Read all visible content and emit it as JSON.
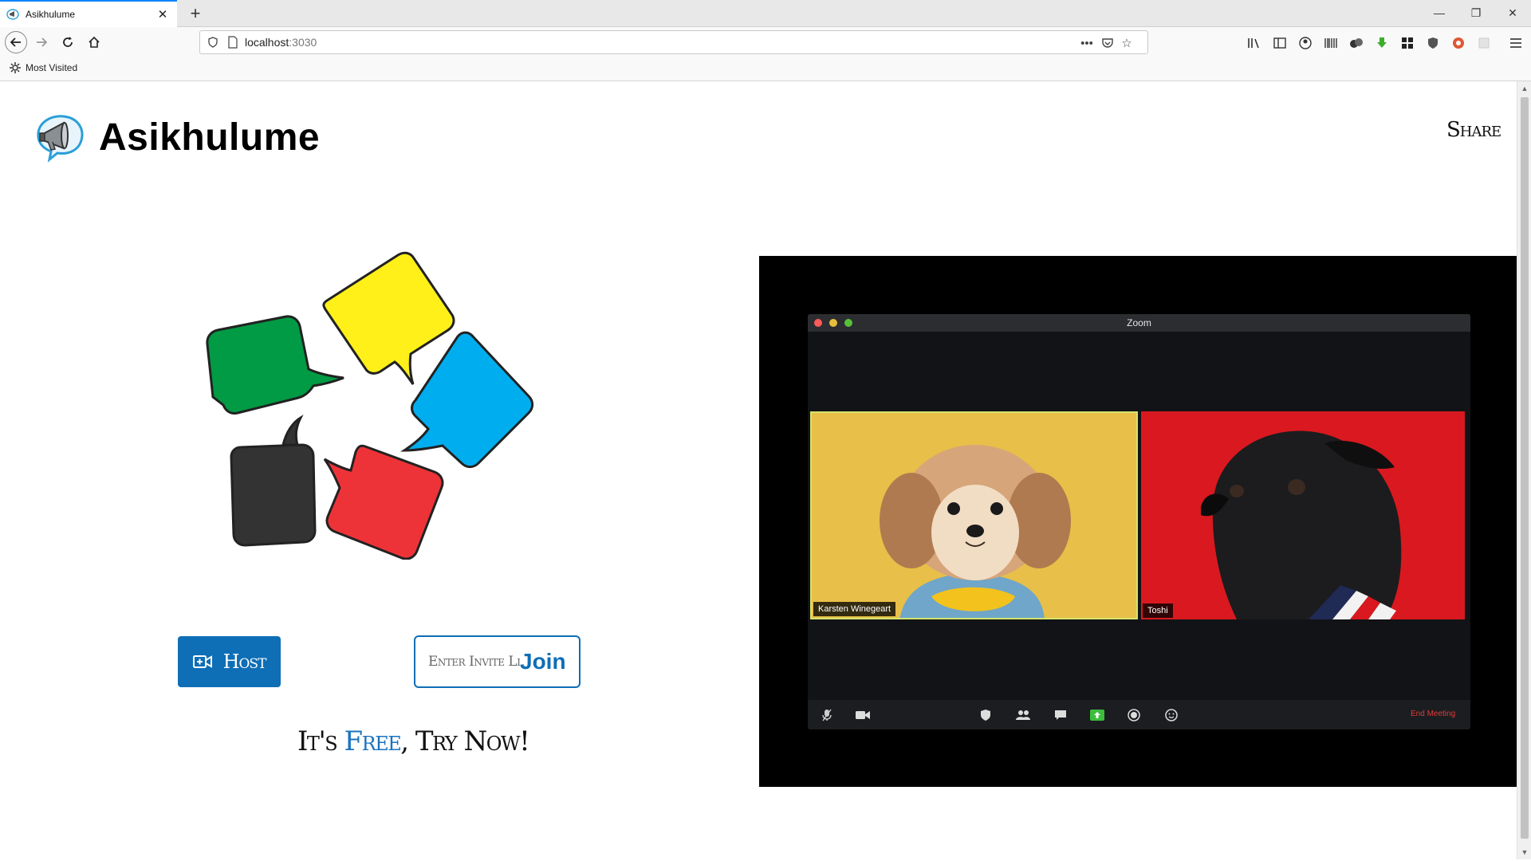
{
  "browser": {
    "tab_title": "Asikhulume",
    "url_host": "localhost",
    "url_port": ":3030",
    "bookmark_label": "Most Visited",
    "page_actions": "•••"
  },
  "header": {
    "brand_name": "Asikhulume",
    "share_label": "Share"
  },
  "hero": {
    "host_label": "Host",
    "invite_placeholder": "Enter Invite Link",
    "join_label": "Join",
    "tagline_prefix": "It's ",
    "tagline_free": "Free",
    "tagline_suffix": ", Try Now!"
  },
  "zoom_preview": {
    "window_title": "Zoom",
    "participants": [
      {
        "name": "Karsten Winegeart"
      },
      {
        "name": "Toshi"
      }
    ],
    "end_meeting_label": "End Meeting"
  },
  "colors": {
    "brand_blue": "#0e6eb6",
    "bubble_yellow": "#fff019",
    "bubble_green": "#009b44",
    "bubble_blue": "#00aeef",
    "bubble_dark": "#333333",
    "bubble_red": "#ee3338"
  },
  "icons": {
    "favicon": "megaphone-icon",
    "host_button": "video-plus-icon"
  }
}
